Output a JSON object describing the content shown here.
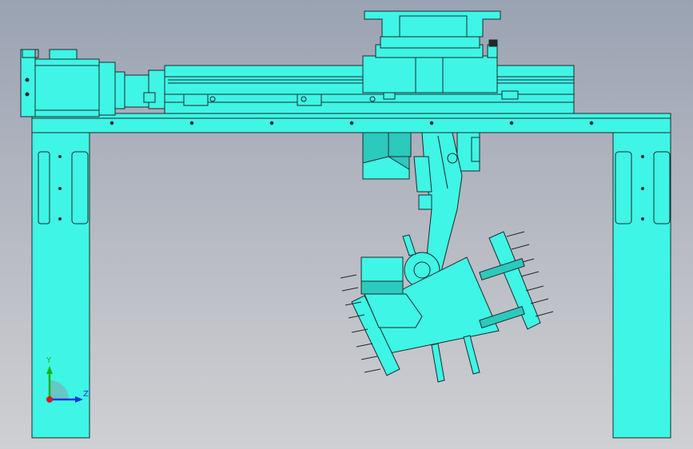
{
  "viewport": {
    "background_top": "#9aa3b3",
    "background_bottom": "#cfd0d3",
    "part_fill": "#3ff5e6",
    "part_stroke": "#1d2a2a",
    "shade_fill": "#2cc9bd"
  },
  "model": {
    "description_icon": "gantry-robot-assembly"
  },
  "triad": {
    "y_label": "Y",
    "z_label": "Z",
    "y_color": "#18b418",
    "z_color": "#1a36d6",
    "x_color": "#d21c1c"
  }
}
